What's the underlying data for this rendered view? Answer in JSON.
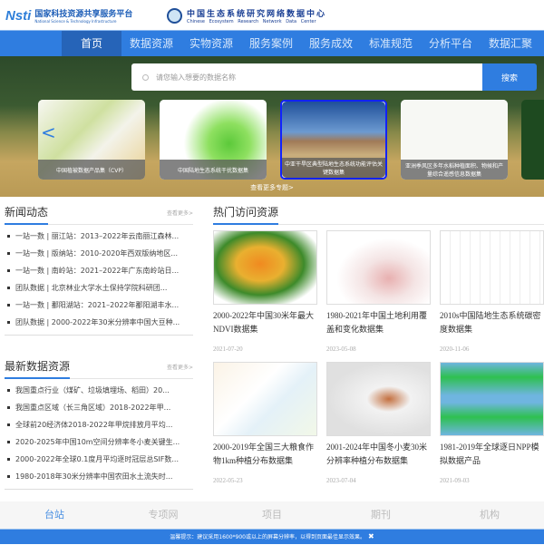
{
  "header": {
    "nsti_logo": "Nsti",
    "nsti_cn": "国家科技资源共享服务平台",
    "nsti_en": "National Science & Technology Infrastructure",
    "cern_cn": "中国生态系统研究网络数据中心",
    "cern_en": "Chinese Ecosystem Research Network Data Center"
  },
  "nav": [
    "首页",
    "数据资源",
    "实物资源",
    "服务案例",
    "服务成效",
    "标准规范",
    "分析平台",
    "数据汇聚"
  ],
  "search": {
    "placeholder": "请您输入想要的数据名称",
    "button": "搜索"
  },
  "carousel": {
    "items": [
      "中国植被数据产品集（CVP）",
      "中国陆地生态系统干扰数据集",
      "中亚干旱区典型陆地生态系统功能评估关键数据集",
      "亚洲季风区多年水稻种植面积、物候和产量综合遥感信息数据集"
    ],
    "more": "查看更多专题>"
  },
  "news": {
    "title": "新闻动态",
    "more": "查看更多>",
    "items": [
      "一站一数 | 丽江站：2013–2022年云南丽江森林...",
      "一站一数 | 版纳站：2010-2020年西双版纳地区...",
      "一站一数 | 南岭站：2021–2022年广东南岭站日...",
      "团队数据 | 北京林业大学水土保持学院科研团...",
      "一站一数 | 鄱阳湖站：2021–2022年鄱阳湖丰水...",
      "团队数据 | 2000-2022年30米分辨率中国大豆种..."
    ]
  },
  "latest": {
    "title": "最新数据资源",
    "more": "查看更多>",
    "items": [
      "我国重点行业（煤矿、垃圾填埋场、稻田）20...",
      "我国重点区域（长三角区域）2018-2022年甲...",
      "全球前20经济体2018-2022年甲烷排放月平均...",
      "2020-2025年中国10m空间分辨率冬小麦关键生...",
      "2000-2022年全球0.1度月平均逐时冠层总SIF数...",
      "1980-2018年30米分辨率中国农田水土流失时..."
    ]
  },
  "hot": {
    "title": "热门访问资源",
    "items": [
      {
        "name": "2000-2022年中国30米年最大NDVI数据集",
        "date": "2021-07-20"
      },
      {
        "name": "1980-2021年中国土地利用覆盖和变化数据集",
        "date": "2023-05-08"
      },
      {
        "name": "2010s中国陆地生态系统碳密度数据集",
        "date": "2020-11-06"
      },
      {
        "name": "2000-2019年全国三大粮食作物1km种植分布数据集",
        "date": "2022-05-23"
      },
      {
        "name": "2001-2024年中国冬小麦30米分辨率种植分布数据集",
        "date": "2023-07-04"
      },
      {
        "name": "1981-2019年全球逐日NPP模拟数据产品",
        "date": "2021-09-03"
      }
    ]
  },
  "footer": {
    "tabs": [
      "台站",
      "专项网",
      "项目",
      "期刊",
      "机构"
    ],
    "tip": "温馨提示：建议采用1600*900或以上的屏幕分辨率，以得到页面最佳显示效果。",
    "close": "✖"
  }
}
